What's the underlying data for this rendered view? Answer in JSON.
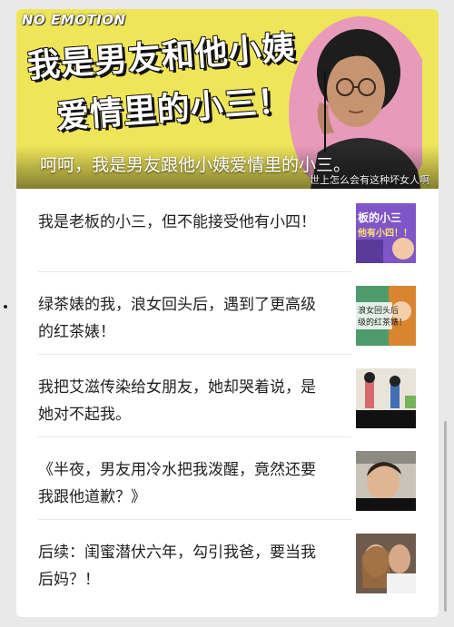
{
  "hero": {
    "brand": "NO EMOTION",
    "title_line1": "我是男友和他小姨",
    "title_line2": "爱情里的小三！",
    "caption": "呵呵，我是男友跟他小姨爱情里的小三。",
    "subcaption": "世上怎么会有这种坏女人啊",
    "accent_color": "#efe558"
  },
  "articles": [
    {
      "text": "我是老板的小三，但不能接受他有小四！",
      "thumb_text": "板的小三\n他有小四！！",
      "thumb_icon": "cartoon-thumbnail"
    },
    {
      "text": "绿茶婊的我，浪女回头后，遇到了更高级的红茶婊！",
      "thumb_text": "浪女回头后\n级的红茶婊！",
      "thumb_icon": "cartoon-thumbnail"
    },
    {
      "text": "我把艾滋传染给女朋友，她却哭着说，是她对不起我。",
      "thumb_text": "",
      "thumb_icon": "cartoon-thumbnail"
    },
    {
      "text": "《半夜，男友用冷水把我泼醒，竟然还要我跟他道歉？》",
      "thumb_text": "",
      "thumb_icon": "photo-thumbnail"
    },
    {
      "text": "后续：闺蜜潜伏六年，勾引我爸，要当我后妈？！",
      "thumb_text": "",
      "thumb_icon": "photo-thumbnail"
    }
  ]
}
